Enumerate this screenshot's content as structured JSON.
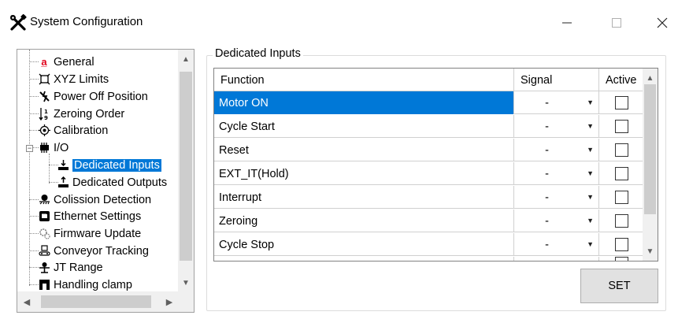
{
  "window": {
    "title": "System Configuration",
    "icon": "tools-icon",
    "controls": {
      "minimize": "—",
      "maximize": "☐",
      "close": "✕"
    }
  },
  "tree": {
    "items": [
      {
        "label": "General",
        "icon": "general-icon",
        "color": "#e0001a"
      },
      {
        "label": "XYZ Limits",
        "icon": "xyz-limits-icon"
      },
      {
        "label": "Power Off Position",
        "icon": "power-off-icon"
      },
      {
        "label": "Zeroing Order",
        "icon": "zeroing-order-icon"
      },
      {
        "label": "Calibration",
        "icon": "calibration-icon"
      },
      {
        "label": "I/O",
        "icon": "io-icon",
        "expanded": true
      },
      {
        "label": "Dedicated Inputs",
        "icon": "dedicated-inputs-icon",
        "selected": true
      },
      {
        "label": "Dedicated Outputs",
        "icon": "dedicated-outputs-icon"
      },
      {
        "label": "Colission Detection",
        "icon": "collision-icon"
      },
      {
        "label": "Ethernet Settings",
        "icon": "ethernet-icon"
      },
      {
        "label": "Firmware Update",
        "icon": "firmware-icon"
      },
      {
        "label": "Conveyor Tracking",
        "icon": "conveyor-icon"
      },
      {
        "label": "JT Range",
        "icon": "jt-range-icon"
      },
      {
        "label": "Handling clamp",
        "icon": "clamp-icon"
      }
    ]
  },
  "group": {
    "title": "Dedicated Inputs"
  },
  "grid": {
    "columns": [
      "Function",
      "Signal",
      "Active"
    ],
    "rows": [
      {
        "function": "Motor ON",
        "signal": "-",
        "active": false,
        "selected": true
      },
      {
        "function": "Cycle Start",
        "signal": "-",
        "active": false
      },
      {
        "function": "Reset",
        "signal": "-",
        "active": false
      },
      {
        "function": "EXT_IT(Hold)",
        "signal": "-",
        "active": false
      },
      {
        "function": "Interrupt",
        "signal": "-",
        "active": false
      },
      {
        "function": "Zeroing",
        "signal": "-",
        "active": false
      },
      {
        "function": "Cycle Stop",
        "signal": "-",
        "active": false
      }
    ]
  },
  "buttons": {
    "set": "SET"
  },
  "colors": {
    "selection": "#0078d7",
    "button_bg": "#e1e1e1"
  }
}
